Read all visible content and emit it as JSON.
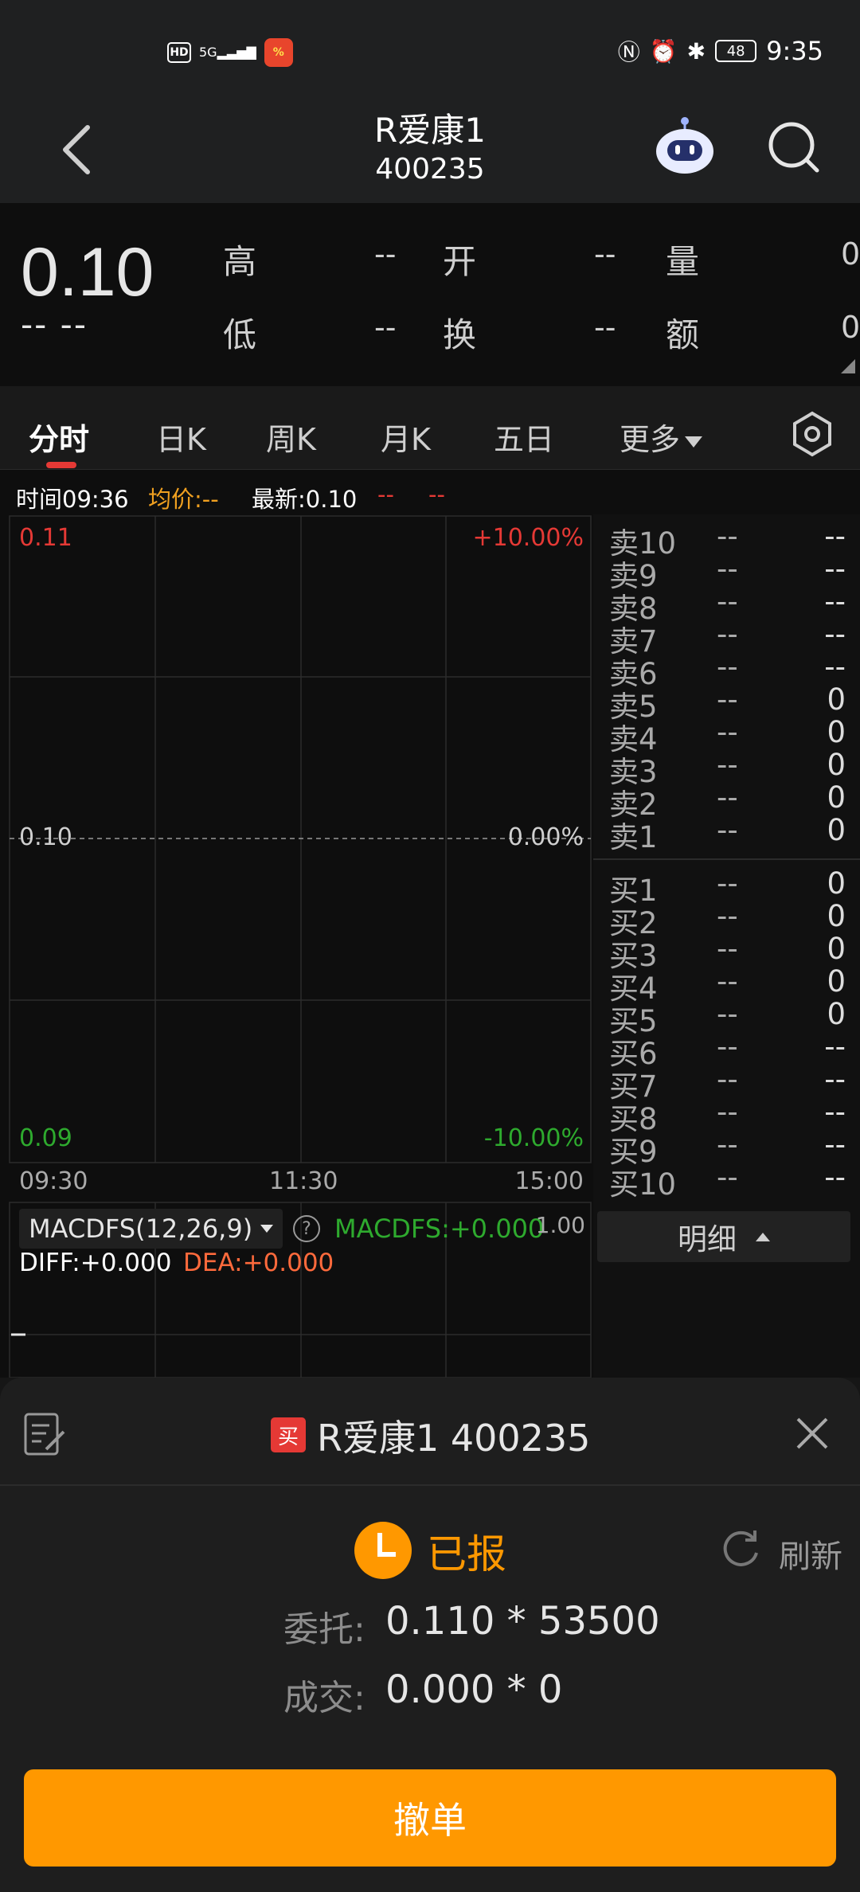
{
  "status_bar": {
    "hd": "HD",
    "signal": "5G",
    "battery": "48",
    "time": "9:35"
  },
  "header": {
    "title": "R爱康1",
    "code": "400235"
  },
  "quote": {
    "price": "0.10",
    "change": "-- --",
    "labels": {
      "high": "高",
      "open": "开",
      "volume": "量",
      "low": "低",
      "turnover": "换",
      "amount": "额"
    },
    "values": {
      "high": "--",
      "open": "--",
      "volume": "0",
      "low": "--",
      "turnover": "--",
      "amount": "0"
    }
  },
  "tabs": [
    "分时",
    "日K",
    "周K",
    "月K",
    "五日",
    "更多"
  ],
  "chart_info": {
    "time": "时间09:36",
    "avg": "均价:--",
    "latest": "最新:0.10",
    "chg1": "--",
    "chg2": "--"
  },
  "chart": {
    "y_top": "0.11",
    "y_mid": "0.10",
    "y_bot": "0.09",
    "pct_top": "+10.00%",
    "pct_mid": "0.00%",
    "pct_bot": "-10.00%",
    "x_start": "09:30",
    "x_mid": "11:30",
    "x_end": "15:00"
  },
  "macd": {
    "selector": "MACDFS(12,26,9)",
    "macdfs": "MACDFS:+0.000",
    "scale": "1.00",
    "diff": "DIFF:+0.000",
    "dea": "DEA:+0.000"
  },
  "order_book": {
    "sell": [
      {
        "label": "卖10",
        "price": "--",
        "vol": "--"
      },
      {
        "label": "卖9",
        "price": "--",
        "vol": "--"
      },
      {
        "label": "卖8",
        "price": "--",
        "vol": "--"
      },
      {
        "label": "卖7",
        "price": "--",
        "vol": "--"
      },
      {
        "label": "卖6",
        "price": "--",
        "vol": "--"
      },
      {
        "label": "卖5",
        "price": "--",
        "vol": "0"
      },
      {
        "label": "卖4",
        "price": "--",
        "vol": "0"
      },
      {
        "label": "卖3",
        "price": "--",
        "vol": "0"
      },
      {
        "label": "卖2",
        "price": "--",
        "vol": "0"
      },
      {
        "label": "卖1",
        "price": "--",
        "vol": "0"
      }
    ],
    "buy": [
      {
        "label": "买1",
        "price": "--",
        "vol": "0"
      },
      {
        "label": "买2",
        "price": "--",
        "vol": "0"
      },
      {
        "label": "买3",
        "price": "--",
        "vol": "0"
      },
      {
        "label": "买4",
        "price": "--",
        "vol": "0"
      },
      {
        "label": "买5",
        "price": "--",
        "vol": "0"
      },
      {
        "label": "买6",
        "price": "--",
        "vol": "--"
      },
      {
        "label": "买7",
        "price": "--",
        "vol": "--"
      },
      {
        "label": "买8",
        "price": "--",
        "vol": "--"
      },
      {
        "label": "买9",
        "price": "--",
        "vol": "--"
      },
      {
        "label": "买10",
        "price": "--",
        "vol": "--"
      }
    ],
    "detail_label": "明细"
  },
  "order_sheet": {
    "badge": "买",
    "title": "R爱康1 400235",
    "status": "已报",
    "refresh": "刷新",
    "entrust_label": "委托:",
    "entrust_value": "0.110 * 53500",
    "deal_label": "成交:",
    "deal_value": "0.000 * 0",
    "cancel_label": "撤单"
  },
  "colors": {
    "up": "#e53935",
    "down": "#2eaa2e",
    "accent": "#ff9800",
    "avg": "#f0a020"
  }
}
